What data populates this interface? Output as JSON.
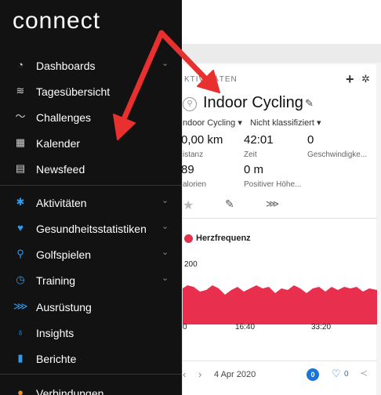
{
  "app": {
    "logo": "connect"
  },
  "sidebar": {
    "items": [
      {
        "label": "Dashboards",
        "icon": "dashboard-icon",
        "has_chevron": true
      },
      {
        "label": "Tagesübersicht",
        "icon": "layers-icon",
        "has_chevron": false
      },
      {
        "label": "Challenges",
        "icon": "challenges-icon",
        "has_chevron": false
      },
      {
        "label": "Kalender",
        "icon": "calendar-icon",
        "has_chevron": false
      },
      {
        "label": "Newsfeed",
        "icon": "newsfeed-icon",
        "has_chevron": false
      },
      {
        "label": "Aktivitäten",
        "icon": "running-person-icon",
        "has_chevron": true
      },
      {
        "label": "Gesundheitsstatistiken",
        "icon": "heart-icon",
        "has_chevron": true
      },
      {
        "label": "Golfspielen",
        "icon": "golfer-icon",
        "has_chevron": true
      },
      {
        "label": "Training",
        "icon": "stopwatch-icon",
        "has_chevron": true
      },
      {
        "label": "Ausrüstung",
        "icon": "shoe-icon",
        "has_chevron": false
      },
      {
        "label": "Insights",
        "icon": "lightbulb-icon",
        "has_chevron": false
      },
      {
        "label": "Berichte",
        "icon": "bar-chart-icon",
        "has_chevron": false
      },
      {
        "label": "Verbindungen",
        "icon": "people-icon",
        "has_chevron": false
      }
    ]
  },
  "activity": {
    "section_label": "KTIVITÄTEN",
    "title": "Indoor Cycling",
    "type_tag": "ndoor Cycling ▾",
    "class_tag": "Nicht klassifiziert ▾",
    "stats": [
      {
        "value": "0,00 km",
        "label": "istanz"
      },
      {
        "value": "42:01",
        "label": "Zeit"
      },
      {
        "value": "0",
        "label": "Geschwindigke..."
      },
      {
        "value": "89",
        "label": "alorien"
      },
      {
        "value": "0 m",
        "label": "Positiver Höhe..."
      }
    ],
    "chart_legend": "Herzfrequenz",
    "y_tick": "200",
    "x_ticks": [
      "0",
      "16:40",
      "33:20"
    ],
    "date": "4 Apr 2020",
    "comment_count": "0",
    "like_count": "0"
  },
  "colors": {
    "sidebar_bg": "#121212",
    "arrow": "#e8302e",
    "chart_fill": "#e8304e",
    "accent_blue": "#1a73d9"
  }
}
